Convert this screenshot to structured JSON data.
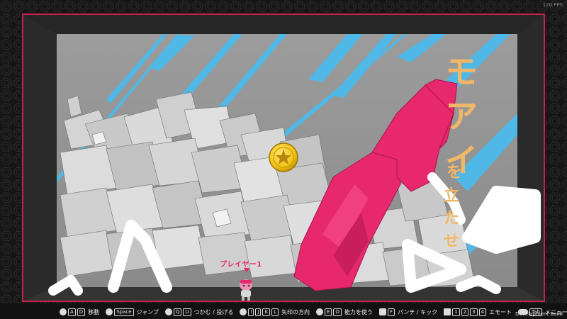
{
  "hud": {
    "fps": "120 FPS",
    "player_label": "プレイヤー1",
    "dev_build": "Development Build"
  },
  "title": {
    "line1": [
      "モ",
      "ア",
      "イ"
    ],
    "line2": [
      "を",
      "立",
      "た",
      "せ"
    ]
  },
  "controls": [
    {
      "icon": "stick-icon",
      "keys": [
        "A",
        "D"
      ],
      "label": "移動"
    },
    {
      "icon": "buttons-icon",
      "keys": [
        "Space"
      ],
      "label": "ジャンプ"
    },
    {
      "icon": "bumper-icon",
      "keys": [
        "Q",
        "U"
      ],
      "label": "つかむ / 投げる"
    },
    {
      "icon": "stick-icon",
      "keys": [
        "I",
        "J",
        "K",
        "L"
      ],
      "label": "矢印の方向"
    },
    {
      "icon": "buttons-icon",
      "keys": [
        "E",
        "O"
      ],
      "label": "能力を使う"
    },
    {
      "icon": "face-button-icon",
      "keys": [
        "F"
      ],
      "label": "パンチ / キック"
    },
    {
      "icon": "dpad-icon",
      "keys": [
        "1",
        "2",
        "3",
        "4"
      ],
      "label": "エモート"
    },
    {
      "icon": "start-button-icon",
      "keys": [
        "Tab"
      ],
      "label": "メニュー"
    }
  ],
  "colors": {
    "frame_accent": "#e8286c",
    "moai": "#e8286c",
    "coin": "#f2c414",
    "stripes": "#4fb8e6",
    "title_text": "#f2b766"
  }
}
